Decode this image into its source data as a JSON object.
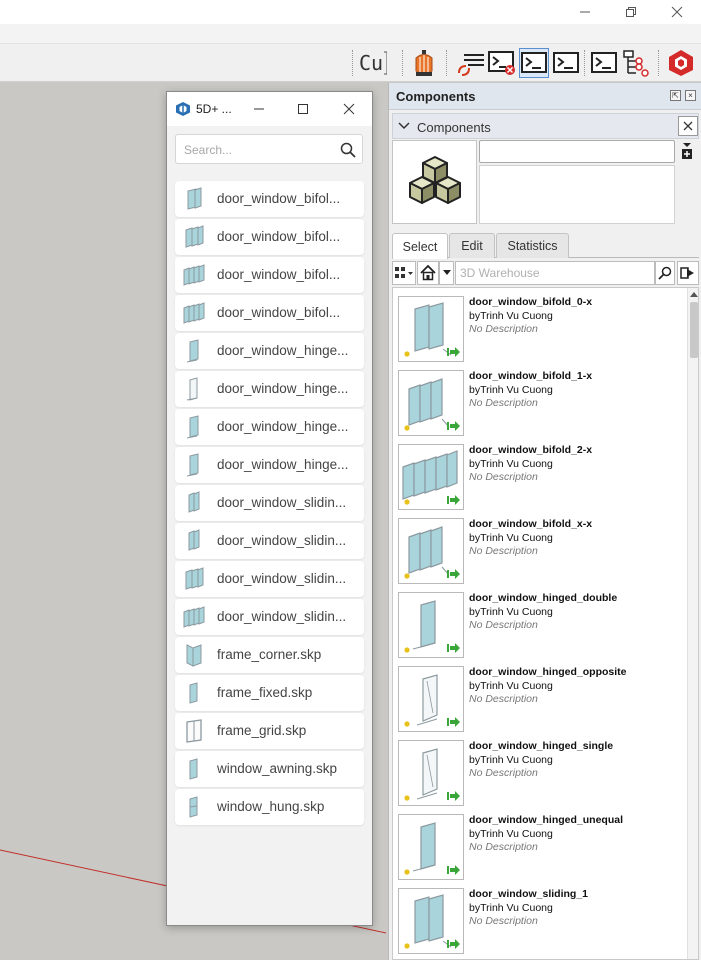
{
  "colors": {
    "accent": "#5b8fd0",
    "glass": "#a9d4dc",
    "frame": "#8c9aa0",
    "marker_green": "#3aa63a",
    "marker_yellow": "#e8c21a",
    "axis_red": "#c2302c"
  },
  "toolbar": {
    "cu_text": "Cu",
    "icons": [
      "cu-text-icon",
      "lantern-icon",
      "refresh-list-icon",
      "console-close-icon",
      "ruby-console-icon",
      "ruby-console-2-icon",
      "ruby-console-3-icon",
      "tree-icon",
      "extension-warehouse-icon"
    ]
  },
  "plugin_window": {
    "title": "5D+ ...",
    "search_placeholder": "Search...",
    "files": [
      {
        "name": "door_window_bifol...",
        "thumb": "bifold-1"
      },
      {
        "name": "door_window_bifol...",
        "thumb": "bifold-2"
      },
      {
        "name": "door_window_bifol...",
        "thumb": "bifold-3"
      },
      {
        "name": "door_window_bifol...",
        "thumb": "bifold-3"
      },
      {
        "name": "door_window_hinge...",
        "thumb": "single"
      },
      {
        "name": "door_window_hinge...",
        "thumb": "single-light"
      },
      {
        "name": "door_window_hinge...",
        "thumb": "single"
      },
      {
        "name": "door_window_hinge...",
        "thumb": "single"
      },
      {
        "name": "door_window_slidin...",
        "thumb": "sliding"
      },
      {
        "name": "door_window_slidin...",
        "thumb": "sliding"
      },
      {
        "name": "door_window_slidin...",
        "thumb": "bifold-2"
      },
      {
        "name": "door_window_slidin...",
        "thumb": "bifold-3"
      },
      {
        "name": "frame_corner.skp",
        "thumb": "corner"
      },
      {
        "name": "frame_fixed.skp",
        "thumb": "fixed"
      },
      {
        "name": "frame_grid.skp",
        "thumb": "grid"
      },
      {
        "name": "window_awning.skp",
        "thumb": "fixed"
      },
      {
        "name": "window_hung.skp",
        "thumb": "hung"
      }
    ]
  },
  "tray": {
    "title": "Components",
    "section_label": "Components",
    "name_value": "",
    "description_value": "",
    "tabs": [
      "Select",
      "Edit",
      "Statistics"
    ],
    "active_tab": "Select",
    "search_placeholder": "3D Warehouse",
    "results": [
      {
        "name": "door_window_bifold_0-x",
        "author": "byTrinh Vu Cuong",
        "description": "No Description",
        "thumb": "bifold-2"
      },
      {
        "name": "door_window_bifold_1-x",
        "author": "byTrinh Vu Cuong",
        "description": "No Description",
        "thumb": "bifold-3"
      },
      {
        "name": "door_window_bifold_2-x",
        "author": "byTrinh Vu Cuong",
        "description": "No Description",
        "thumb": "bifold-4"
      },
      {
        "name": "door_window_bifold_x-x",
        "author": "byTrinh Vu Cuong",
        "description": "No Description",
        "thumb": "bifold-3"
      },
      {
        "name": "door_window_hinged_double",
        "author": "byTrinh Vu Cuong",
        "description": "No Description",
        "thumb": "single"
      },
      {
        "name": "door_window_hinged_opposite",
        "author": "byTrinh Vu Cuong",
        "description": "No Description",
        "thumb": "single-light"
      },
      {
        "name": "door_window_hinged_single",
        "author": "byTrinh Vu Cuong",
        "description": "No Description",
        "thumb": "single-light"
      },
      {
        "name": "door_window_hinged_unequal",
        "author": "byTrinh Vu Cuong",
        "description": "No Description",
        "thumb": "single"
      },
      {
        "name": "door_window_sliding_1",
        "author": "byTrinh Vu Cuong",
        "description": "No Description",
        "thumb": "bifold-2"
      }
    ]
  }
}
